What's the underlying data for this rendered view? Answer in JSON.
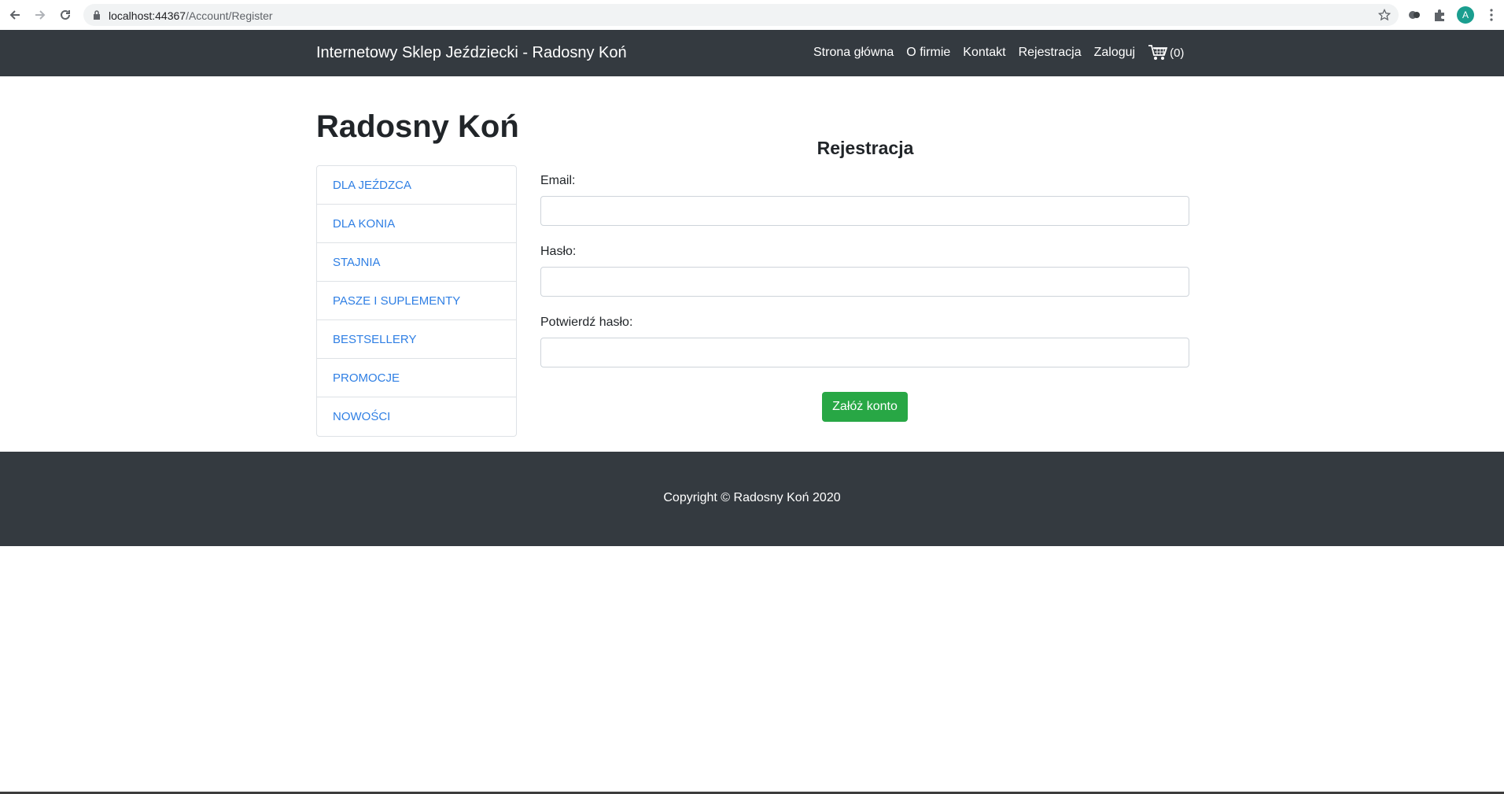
{
  "browser": {
    "url_host": "localhost:44367",
    "url_path": "/Account/Register",
    "avatar_letter": "A"
  },
  "navbar": {
    "brand": "Internetowy Sklep Jeździecki - Radosny Koń",
    "links": [
      "Strona główna",
      "O firmie",
      "Kontakt",
      "Rejestracja",
      "Zaloguj"
    ],
    "cart_count": "(0)"
  },
  "main": {
    "title": "Radosny Koń",
    "categories": [
      "DLA JEŹDZCA",
      "DLA KONIA",
      "STAJNIA",
      "PASZE I SUPLEMENTY",
      "BESTSELLERY",
      "PROMOCJE",
      "NOWOŚCI"
    ],
    "form": {
      "title": "Rejestracja",
      "email_label": "Email:",
      "email_value": "",
      "password_label": "Hasło:",
      "password_value": "",
      "confirm_label": "Potwierdź hasło:",
      "confirm_value": "",
      "submit_label": "Załóż konto"
    }
  },
  "footer": {
    "text": "Copyright © Radosny Koń 2020"
  },
  "colors": {
    "navbar_bg": "#343a40",
    "link": "#2f7fe4",
    "success": "#28a745"
  }
}
